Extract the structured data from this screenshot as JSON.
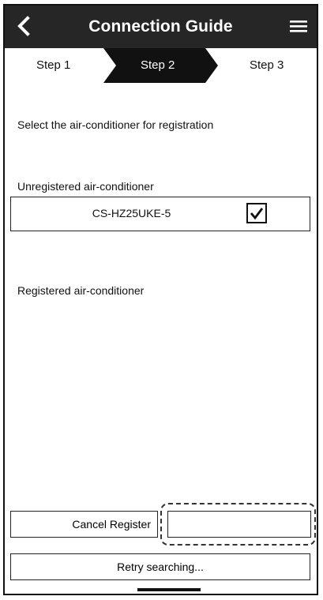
{
  "header": {
    "title": "Connection Guide",
    "back_icon": "chevron-left-icon",
    "menu_icon": "hamburger-menu-icon"
  },
  "steps": {
    "items": [
      "Step 1",
      "Step 2",
      "Step 3"
    ],
    "active_index": 1
  },
  "main": {
    "prompt": "Select the air-conditioner for registration",
    "unregistered_label": "Unregistered air-conditioner",
    "unregistered_devices": [
      {
        "name": "CS-HZ25UKE-5",
        "checked": true
      }
    ],
    "registered_label": "Registered air-conditioner"
  },
  "buttons": {
    "cancel_register": "Cancel Register",
    "register": "",
    "retry": "Retry searching..."
  },
  "colors": {
    "header_bg": "#262626",
    "active_step_bg": "#111111"
  }
}
